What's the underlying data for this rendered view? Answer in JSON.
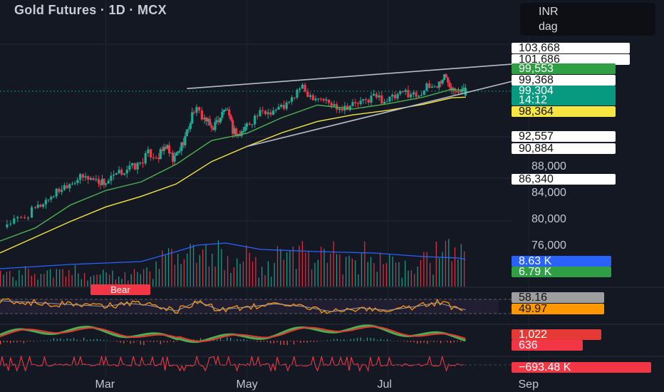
{
  "header": {
    "title": "Gold Futures · 1D · MCX"
  },
  "unit_box": {
    "currency": "INR",
    "unit": "dag"
  },
  "price_tags": [
    {
      "id": "level-103668",
      "label": "103,668",
      "value": 103668,
      "bg": "#ffffff",
      "fg": "#111111"
    },
    {
      "id": "level-101686",
      "label": "101,686",
      "value": 101686,
      "bg": "#ffffff",
      "fg": "#111111"
    },
    {
      "id": "level-99553",
      "label": "99,553",
      "value": 99553,
      "bg": "#2f9e44",
      "fg": "#ffffff"
    },
    {
      "id": "level-99368",
      "label": "99,368",
      "value": 99368,
      "bg": "#ffffff",
      "fg": "#111111"
    },
    {
      "id": "last-price",
      "label": "99,304",
      "value": 99304,
      "bg": "#089981",
      "fg": "#ffffff"
    },
    {
      "id": "countdown",
      "label": "14:12",
      "value": null,
      "bg": "#089981",
      "fg": "#ffffff"
    },
    {
      "id": "level-98364",
      "label": "98,364",
      "value": 98364,
      "bg": "#f5e642",
      "fg": "#111111"
    },
    {
      "id": "level-92557",
      "label": "92,557",
      "value": 92557,
      "bg": "#ffffff",
      "fg": "#111111"
    },
    {
      "id": "level-90884",
      "label": "90,884",
      "value": 90884,
      "bg": "#ffffff",
      "fg": "#111111"
    },
    {
      "id": "level-86340",
      "label": "86,340",
      "value": 86340,
      "bg": "#ffffff",
      "fg": "#111111"
    }
  ],
  "indicator_tags": [
    {
      "id": "vol-avg",
      "label": "8.63 K",
      "bg": "#2962ff",
      "fg": "#ffffff"
    },
    {
      "id": "vol-last",
      "label": "6.79 K",
      "bg": "#2f9e44",
      "fg": "#ffffff"
    },
    {
      "id": "rsi-ma",
      "label": "58.16",
      "bg": "#9e9e9e",
      "fg": "#111111"
    },
    {
      "id": "rsi",
      "label": "49.97",
      "bg": "#ff9800",
      "fg": "#111111"
    },
    {
      "id": "macd-a",
      "label": "1,022",
      "bg": "#e53935",
      "fg": "#ffffff"
    },
    {
      "id": "macd-b",
      "label": "636",
      "bg": "#f23645",
      "fg": "#ffffff"
    },
    {
      "id": "obv",
      "label": "−693.48 K",
      "bg": "#f23645",
      "fg": "#ffffff"
    }
  ],
  "colors": {
    "up": "#22ab94",
    "down": "#f23645",
    "ema_short": "#4caf50",
    "ema_long": "#f5e642",
    "volume_ma": "#2962ff",
    "rsi": "#ff9800",
    "macd_line": "#4caf50",
    "signal_line": "#e53935",
    "background": "#141823",
    "trendline": "#b8bcc6"
  },
  "bear_label": "Bear",
  "chart_data": {
    "type": "candlestick",
    "title": "Gold Futures · 1D · MCX",
    "x_ticks": [
      "Mar",
      "May",
      "Jul",
      "Sep"
    ],
    "y_ticks": [
      "88,000",
      "84,000",
      "80,000",
      "76,000"
    ],
    "y_tick_values": [
      88000,
      84000,
      80000,
      76000
    ],
    "y_range": [
      71000,
      106500
    ],
    "x_range_months": [
      1.5,
      9.4
    ],
    "pattern": "rising wedge",
    "close_series": [
      {
        "m": 1.6,
        "c": 79200
      },
      {
        "m": 1.8,
        "c": 79900
      },
      {
        "m": 2.0,
        "c": 81300
      },
      {
        "m": 2.15,
        "c": 82700
      },
      {
        "m": 2.3,
        "c": 84000
      },
      {
        "m": 2.45,
        "c": 85200
      },
      {
        "m": 2.6,
        "c": 86000
      },
      {
        "m": 2.75,
        "c": 86200
      },
      {
        "m": 2.9,
        "c": 85600
      },
      {
        "m": 3.0,
        "c": 85400
      },
      {
        "m": 3.15,
        "c": 86500
      },
      {
        "m": 3.3,
        "c": 87500
      },
      {
        "m": 3.45,
        "c": 88000
      },
      {
        "m": 3.6,
        "c": 89800
      },
      {
        "m": 3.75,
        "c": 89400
      },
      {
        "m": 3.85,
        "c": 91000
      },
      {
        "m": 3.95,
        "c": 88700
      },
      {
        "m": 4.05,
        "c": 90500
      },
      {
        "m": 4.15,
        "c": 93000
      },
      {
        "m": 4.25,
        "c": 96600
      },
      {
        "m": 4.4,
        "c": 95200
      },
      {
        "m": 4.5,
        "c": 93600
      },
      {
        "m": 4.6,
        "c": 95000
      },
      {
        "m": 4.7,
        "c": 96700
      },
      {
        "m": 4.8,
        "c": 93400
      },
      {
        "m": 4.9,
        "c": 92600
      },
      {
        "m": 5.0,
        "c": 94200
      },
      {
        "m": 5.15,
        "c": 95700
      },
      {
        "m": 5.3,
        "c": 96200
      },
      {
        "m": 5.45,
        "c": 96700
      },
      {
        "m": 5.6,
        "c": 97400
      },
      {
        "m": 5.75,
        "c": 99900
      },
      {
        "m": 5.9,
        "c": 98700
      },
      {
        "m": 6.05,
        "c": 98300
      },
      {
        "m": 6.2,
        "c": 97200
      },
      {
        "m": 6.35,
        "c": 96900
      },
      {
        "m": 6.5,
        "c": 97300
      },
      {
        "m": 6.65,
        "c": 97600
      },
      {
        "m": 6.8,
        "c": 98600
      },
      {
        "m": 6.95,
        "c": 97900
      },
      {
        "m": 7.1,
        "c": 98300
      },
      {
        "m": 7.25,
        "c": 99200
      },
      {
        "m": 7.4,
        "c": 98700
      },
      {
        "m": 7.55,
        "c": 99800
      },
      {
        "m": 7.7,
        "c": 100200
      },
      {
        "m": 7.8,
        "c": 101600
      },
      {
        "m": 7.9,
        "c": 100100
      },
      {
        "m": 8.0,
        "c": 99700
      },
      {
        "m": 8.1,
        "c": 99300
      }
    ],
    "ema_short": [
      {
        "m": 1.5,
        "v": 76500
      },
      {
        "m": 2.0,
        "v": 78500
      },
      {
        "m": 2.5,
        "v": 82000
      },
      {
        "m": 3.0,
        "v": 84200
      },
      {
        "m": 3.5,
        "v": 85500
      },
      {
        "m": 4.0,
        "v": 88200
      },
      {
        "m": 4.5,
        "v": 91800
      },
      {
        "m": 5.0,
        "v": 92900
      },
      {
        "m": 5.5,
        "v": 95300
      },
      {
        "m": 6.0,
        "v": 97200
      },
      {
        "m": 6.5,
        "v": 96600
      },
      {
        "m": 7.0,
        "v": 97400
      },
      {
        "m": 7.5,
        "v": 98400
      },
      {
        "m": 7.9,
        "v": 99600
      },
      {
        "m": 8.1,
        "v": 99400
      }
    ],
    "ema_long": [
      {
        "m": 1.5,
        "v": 74700
      },
      {
        "m": 2.0,
        "v": 77100
      },
      {
        "m": 2.5,
        "v": 79500
      },
      {
        "m": 3.0,
        "v": 81700
      },
      {
        "m": 3.5,
        "v": 83300
      },
      {
        "m": 4.0,
        "v": 85200
      },
      {
        "m": 4.5,
        "v": 88600
      },
      {
        "m": 5.0,
        "v": 90900
      },
      {
        "m": 5.5,
        "v": 93000
      },
      {
        "m": 6.0,
        "v": 94700
      },
      {
        "m": 6.5,
        "v": 95700
      },
      {
        "m": 7.0,
        "v": 96400
      },
      {
        "m": 7.5,
        "v": 97300
      },
      {
        "m": 7.9,
        "v": 98300
      },
      {
        "m": 8.1,
        "v": 98400
      }
    ],
    "trendlines": [
      {
        "name": "upper",
        "p1": {
          "m": 4.15,
          "v": 99700
        },
        "p2": {
          "m": 9.1,
          "v": 103700
        }
      },
      {
        "name": "lower",
        "p1": {
          "m": 5.0,
          "v": 90900
        },
        "p2": {
          "m": 9.1,
          "v": 101700
        }
      }
    ],
    "rsi": [
      {
        "m": 1.5,
        "v": 64
      },
      {
        "m": 2.0,
        "v": 61
      },
      {
        "m": 2.5,
        "v": 58
      },
      {
        "m": 3.0,
        "v": 55
      },
      {
        "m": 3.3,
        "v": 60
      },
      {
        "m": 3.6,
        "v": 57
      },
      {
        "m": 4.0,
        "v": 48
      },
      {
        "m": 4.3,
        "v": 63
      },
      {
        "m": 4.6,
        "v": 50
      },
      {
        "m": 5.0,
        "v": 54
      },
      {
        "m": 5.4,
        "v": 59
      },
      {
        "m": 5.8,
        "v": 55
      },
      {
        "m": 6.2,
        "v": 47
      },
      {
        "m": 6.6,
        "v": 53
      },
      {
        "m": 7.0,
        "v": 49
      },
      {
        "m": 7.4,
        "v": 55
      },
      {
        "m": 7.7,
        "v": 61
      },
      {
        "m": 8.0,
        "v": 52
      },
      {
        "m": 8.1,
        "v": 50
      }
    ]
  }
}
